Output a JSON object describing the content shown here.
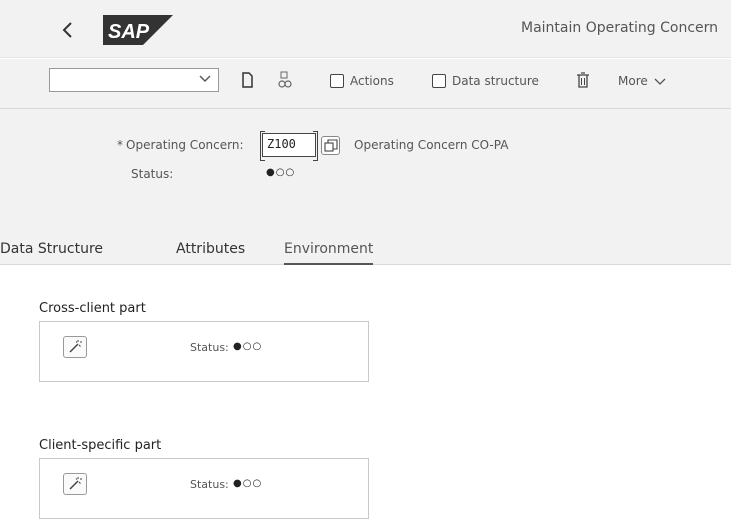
{
  "header": {
    "app_title": "Maintain Operating Concern",
    "logo_text": "SAP"
  },
  "toolbar": {
    "select_value": "",
    "icons": [
      "new-document-icon",
      "find-icon",
      "delete-icon"
    ],
    "actions_label": "Actions",
    "data_structure_label": "Data structure",
    "more_label": "More"
  },
  "form": {
    "required_marker": "*",
    "operating_concern_label": "Operating Concern:",
    "operating_concern_value": "Z100",
    "operating_concern_desc": "Operating Concern CO-PA",
    "status_label": "Status:",
    "status_value": "●○○"
  },
  "tabs": [
    {
      "label": "Data Structure",
      "active": false
    },
    {
      "label": "Attributes",
      "active": false
    },
    {
      "label": "Environment",
      "active": true
    }
  ],
  "sections": [
    {
      "title": "Cross-client part",
      "status_label": "Status:",
      "status_value": "●○○"
    },
    {
      "title": "Client-specific part",
      "status_label": "Status:",
      "status_value": "●○○"
    }
  ]
}
